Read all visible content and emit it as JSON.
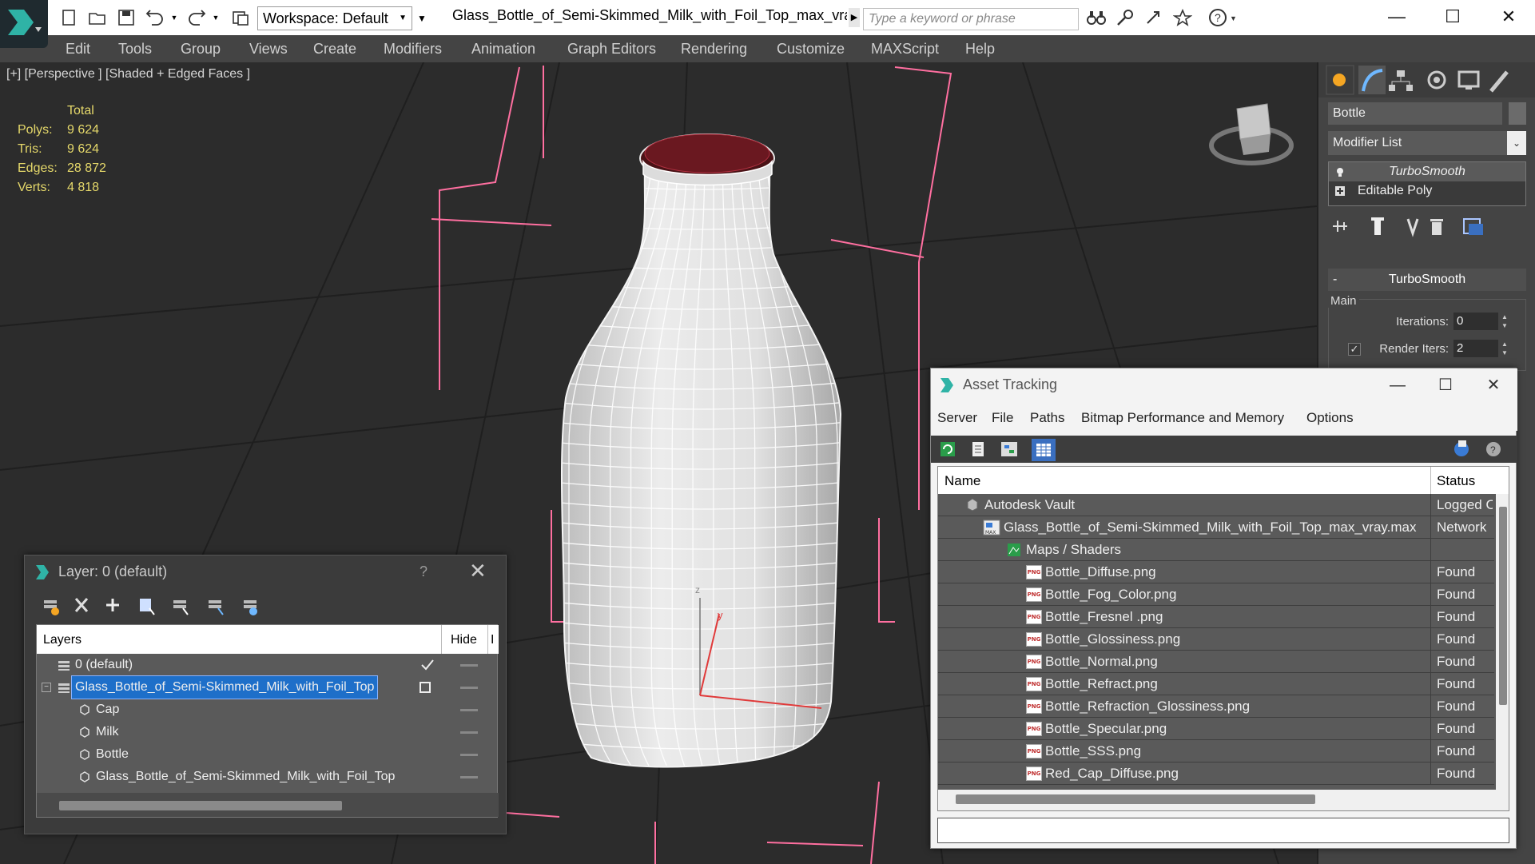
{
  "app": {
    "workspace_label": "Workspace: Default",
    "file_title": "Glass_Bottle_of_Semi-Skimmed_Milk_with_Foil_Top_max_vra...",
    "search_placeholder": "Type a keyword or phrase",
    "accent_color": "#1e6fc9"
  },
  "menu": [
    "Edit",
    "Tools",
    "Group",
    "Views",
    "Create",
    "Modifiers",
    "Animation",
    "Graph Editors",
    "Rendering",
    "Customize",
    "MAXScript",
    "Help"
  ],
  "viewport": {
    "label": "[+] [Perspective ] [Shaded + Edged Faces ]",
    "stats_header": "Total",
    "stats": [
      {
        "label": "Polys:",
        "value": "9 624"
      },
      {
        "label": "Tris:",
        "value": "9 624"
      },
      {
        "label": "Edges:",
        "value": "28 872"
      },
      {
        "label": "Verts:",
        "value": "4 818"
      }
    ],
    "gizmo_axes": {
      "z": "z",
      "y": "y"
    }
  },
  "command_panel": {
    "object_name": "Bottle",
    "modifier_list": "Modifier List",
    "stack": [
      "TurboSmooth",
      "Editable Poly"
    ],
    "rollout_title": "TurboSmooth",
    "rollout_minus": "-",
    "group_label": "Main",
    "iterations_label": "Iterations:",
    "iterations_value": "0",
    "render_iters_label": "Render Iters:",
    "render_iters_value": "2",
    "render_iters_checked": true
  },
  "layer_window": {
    "title": "Layer: 0 (default)",
    "help": "?",
    "close": "✕",
    "col_layers": "Layers",
    "col_hide": "Hide",
    "col_extra": "I",
    "rows": [
      {
        "name": "0 (default)",
        "indent": 0,
        "type": "layer",
        "current": true
      },
      {
        "name": "Glass_Bottle_of_Semi-Skimmed_Milk_with_Foil_Top",
        "indent": 0,
        "type": "layer",
        "selected": true
      },
      {
        "name": "Cap",
        "indent": 1,
        "type": "object"
      },
      {
        "name": "Milk",
        "indent": 1,
        "type": "object"
      },
      {
        "name": "Bottle",
        "indent": 1,
        "type": "object"
      },
      {
        "name": "Glass_Bottle_of_Semi-Skimmed_Milk_with_Foil_Top",
        "indent": 1,
        "type": "object"
      }
    ]
  },
  "asset_window": {
    "title": "Asset Tracking",
    "menu": [
      "Server",
      "File",
      "Paths",
      "Bitmap Performance and Memory",
      "Options"
    ],
    "col_name": "Name",
    "col_status": "Status",
    "rows": [
      {
        "name": "Autodesk Vault",
        "status": "Logged O",
        "indent": 0,
        "icon": "vault-icon"
      },
      {
        "name": "Glass_Bottle_of_Semi-Skimmed_Milk_with_Foil_Top_max_vray.max",
        "status": "Network",
        "indent": 1,
        "icon": "max-file-icon"
      },
      {
        "name": "Maps / Shaders",
        "status": "",
        "indent": 2,
        "icon": "maps-icon"
      },
      {
        "name": "Bottle_Diffuse.png",
        "status": "Found",
        "indent": 3,
        "icon": "png-icon"
      },
      {
        "name": "Bottle_Fog_Color.png",
        "status": "Found",
        "indent": 3,
        "icon": "png-icon"
      },
      {
        "name": "Bottle_Fresnel .png",
        "status": "Found",
        "indent": 3,
        "icon": "png-icon"
      },
      {
        "name": "Bottle_Glossiness.png",
        "status": "Found",
        "indent": 3,
        "icon": "png-icon"
      },
      {
        "name": "Bottle_Normal.png",
        "status": "Found",
        "indent": 3,
        "icon": "png-icon"
      },
      {
        "name": "Bottle_Refract.png",
        "status": "Found",
        "indent": 3,
        "icon": "png-icon"
      },
      {
        "name": "Bottle_Refraction_Glossiness.png",
        "status": "Found",
        "indent": 3,
        "icon": "png-icon"
      },
      {
        "name": "Bottle_Specular.png",
        "status": "Found",
        "indent": 3,
        "icon": "png-icon"
      },
      {
        "name": "Bottle_SSS.png",
        "status": "Found",
        "indent": 3,
        "icon": "png-icon"
      },
      {
        "name": "Red_Cap_Diffuse.png",
        "status": "Found",
        "indent": 3,
        "icon": "png-icon"
      }
    ],
    "png_badge": "PNG"
  }
}
